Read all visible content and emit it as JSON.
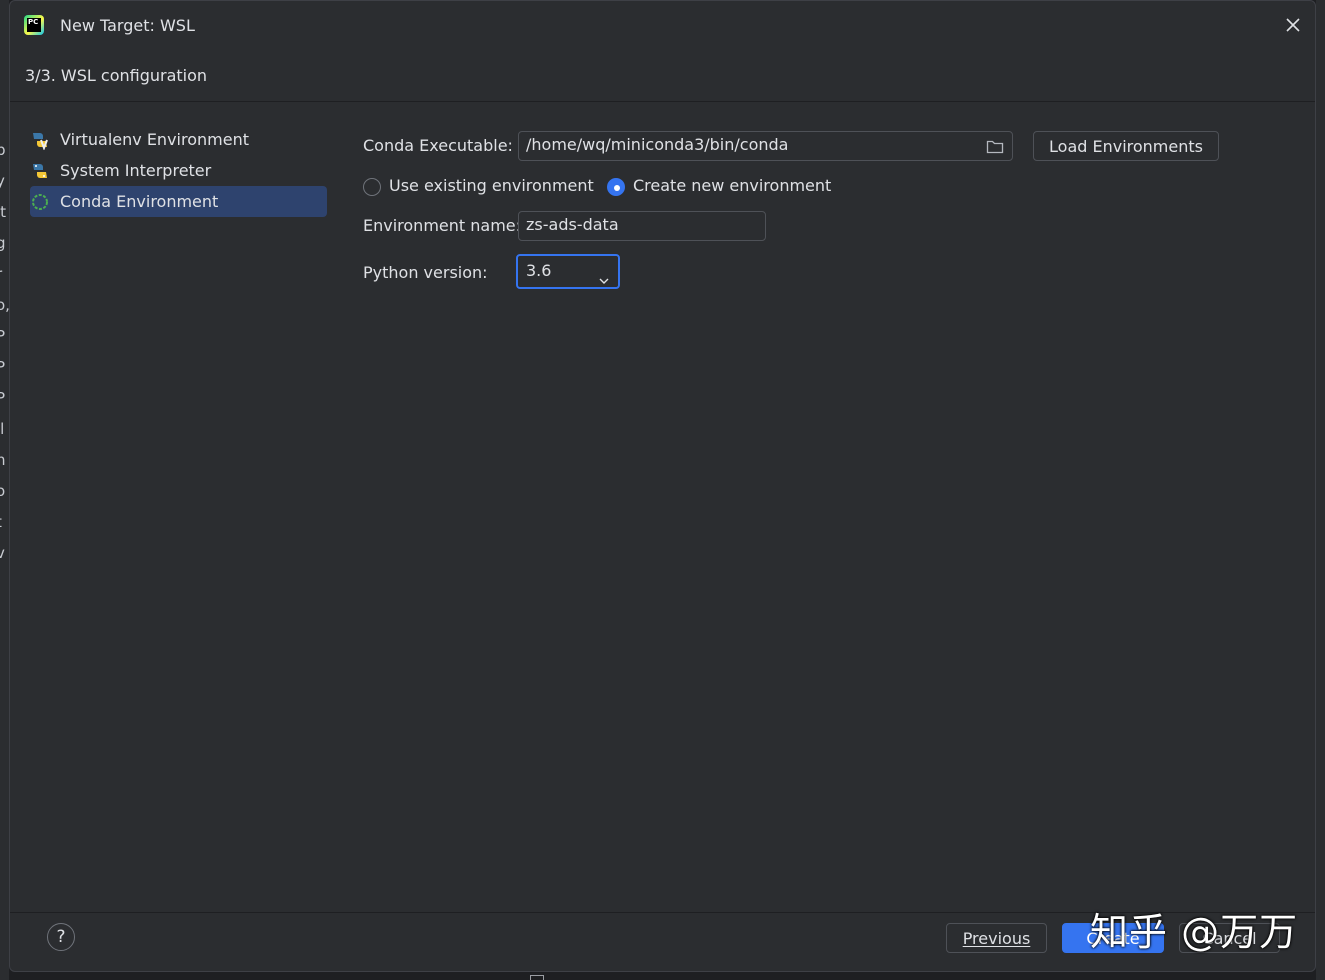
{
  "window": {
    "title": "New Target: WSL",
    "step": "3/3. WSL configuration"
  },
  "background_edge_letters": [
    "p",
    "y",
    "it",
    "g",
    "r",
    "o,",
    "P",
    "P",
    "P",
    "il",
    "n",
    "o",
    "t",
    "v"
  ],
  "sidebar": {
    "items": [
      {
        "label": "Virtualenv Environment",
        "icon": "virtualenv-icon"
      },
      {
        "label": "System Interpreter",
        "icon": "python-icon"
      },
      {
        "label": "Conda Environment",
        "icon": "conda-icon",
        "selected": true
      }
    ]
  },
  "form": {
    "conda_executable_label": "Conda Executable:",
    "conda_executable_value": "/home/wq/miniconda3/bin/conda",
    "load_environments_label": "Load Environments",
    "radio_existing_label": "Use existing environment",
    "radio_new_label": "Create new environment",
    "selected_radio": "new",
    "env_name_label": "Environment name:",
    "env_name_value": "zs-ads-data",
    "python_version_label": "Python version:",
    "python_version_value": "3.6"
  },
  "footer": {
    "help_label": "?",
    "previous_label": "Previous",
    "create_label": "Create",
    "cancel_label": "Cancel"
  },
  "watermark": "知乎 @万万",
  "colors": {
    "accent": "#3574f0",
    "dialog_bg": "#2b2d30",
    "selection_bg": "#2e436e"
  }
}
